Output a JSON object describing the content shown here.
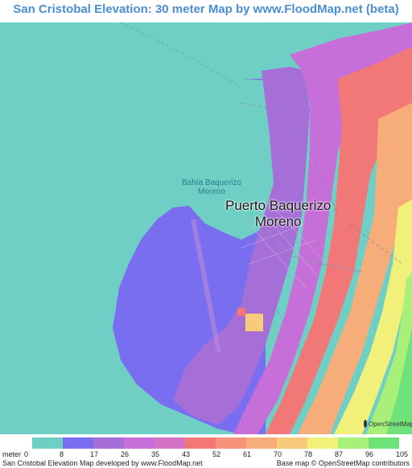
{
  "title": "San Cristobal Elevation: 30 meter Map by www.FloodMap.net (beta)",
  "map": {
    "city_label_line1": "Puerto Baquerizo",
    "city_label_line2": "Moreno",
    "bay_label_line1": "Bahía Baquerizo",
    "bay_label_line2": "Moreno",
    "osm_badge": "OpenStreetMap",
    "sea_color": "#6fcfc4"
  },
  "legend": {
    "unit": "meter",
    "ticks": [
      "0",
      "8",
      "17",
      "26",
      "35",
      "43",
      "52",
      "61",
      "70",
      "78",
      "87",
      "96",
      "105"
    ],
    "colors": [
      "#6fcfc4",
      "#7a6ef0",
      "#a66fd8",
      "#c66fd8",
      "#d672c6",
      "#f27878",
      "#f7937a",
      "#f7ad7a",
      "#f7cb7a",
      "#f0f07a",
      "#a8f07a",
      "#6fe27a"
    ]
  },
  "footer": {
    "left": "San Cristobal Elevation Map developed by www.FloodMap.net",
    "right": "Base map © OpenStreetMap contributors"
  }
}
